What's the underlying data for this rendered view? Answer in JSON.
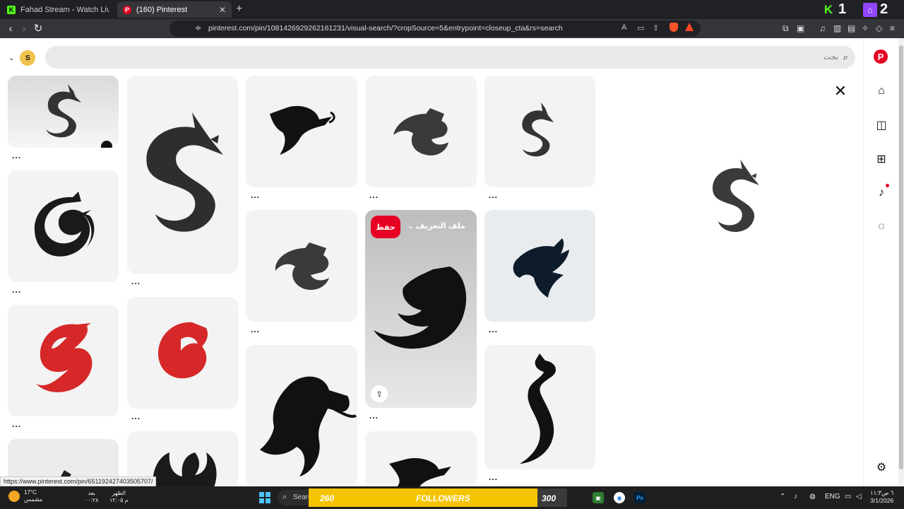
{
  "browser": {
    "tabs": [
      {
        "title": "Fahad Stream - Watch Live on Kick",
        "favicon": "kick-icon"
      },
      {
        "title": "(160) Pinterest",
        "favicon": "pinterest-icon"
      }
    ],
    "url": "pinterest.com/pin/1081426929262161231/visual-search/?cropSource=5&entrypoint=closeup_cta&rs=search",
    "overlay_counters": {
      "kick": "1",
      "twitch": "2"
    },
    "status_url": "https://www.pinterest.com/pin/651192427403505707/"
  },
  "pinterest": {
    "avatar_letter": "S",
    "search_placeholder": "بحث",
    "hover_pin": {
      "save_label": "حفظ",
      "profile_label": "ملف التعريف"
    },
    "more_label": "...",
    "accent": "#e60023"
  },
  "sidebar": {
    "icons": [
      "pinterest-logo-icon",
      "home-icon",
      "explore-icon",
      "create-icon",
      "notifications-icon",
      "messages-icon",
      "settings-icon"
    ]
  },
  "taskbar": {
    "weather_temp": "17°C",
    "weather_desc": "مشمس",
    "prayer_next_label": "بعد",
    "prayer_next_value": "۰۰:۲۸",
    "prayer_name": "الظهر",
    "prayer_time": "۱۲:۰۵ م",
    "search_label": "Search",
    "banner": {
      "left": "260",
      "center": "FOLLOWERS",
      "right": "300"
    },
    "language": "ENG",
    "time": "۱۱:۳٦ ص",
    "date": "3/1/2026"
  }
}
